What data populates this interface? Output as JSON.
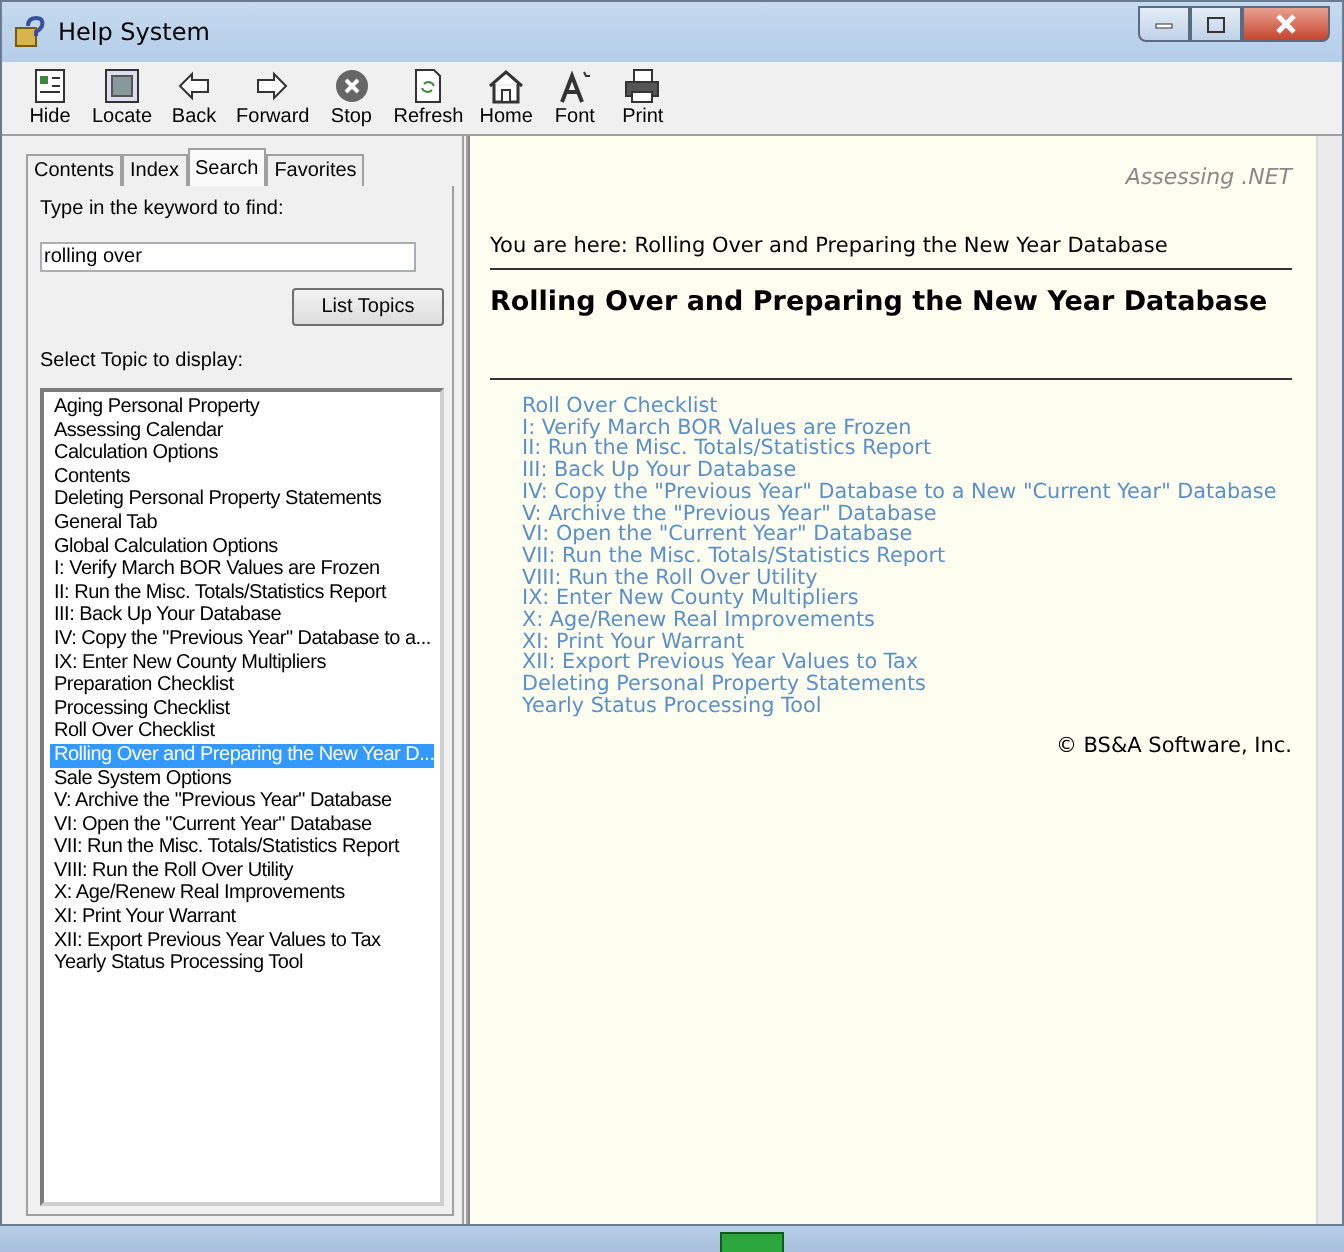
{
  "window": {
    "title": "Help System"
  },
  "toolbar": [
    {
      "label": "Hide",
      "kind": "hide"
    },
    {
      "label": "Locate",
      "kind": "locate"
    },
    {
      "label": "Back",
      "kind": "back"
    },
    {
      "label": "Forward",
      "kind": "forward"
    },
    {
      "label": "Stop",
      "kind": "stop"
    },
    {
      "label": "Refresh",
      "kind": "refresh"
    },
    {
      "label": "Home",
      "kind": "home"
    },
    {
      "label": "Font",
      "kind": "font"
    },
    {
      "label": "Print",
      "kind": "print"
    }
  ],
  "tabs": [
    {
      "label": "Contents",
      "selected": false
    },
    {
      "label": "Index",
      "selected": false
    },
    {
      "label": "Search",
      "selected": true
    },
    {
      "label": "Favorites",
      "selected": false
    }
  ],
  "search": {
    "label": "Type in the keyword to find:",
    "value": "rolling over",
    "button": "List Topics"
  },
  "topics": {
    "label": "Select Topic to display:",
    "items": [
      {
        "label": "Aging Personal Property",
        "selected": false
      },
      {
        "label": "Assessing Calendar",
        "selected": false
      },
      {
        "label": "Calculation Options",
        "selected": false
      },
      {
        "label": "Contents",
        "selected": false
      },
      {
        "label": "Deleting Personal Property Statements",
        "selected": false
      },
      {
        "label": "General Tab",
        "selected": false
      },
      {
        "label": "Global Calculation Options",
        "selected": false
      },
      {
        "label": "I: Verify March BOR Values are Frozen",
        "selected": false
      },
      {
        "label": "II: Run the Misc. Totals/Statistics Report",
        "selected": false
      },
      {
        "label": "III: Back Up Your Database",
        "selected": false
      },
      {
        "label": "IV: Copy the \"Previous Year\" Database to a...",
        "selected": false
      },
      {
        "label": "IX: Enter New County Multipliers",
        "selected": false
      },
      {
        "label": "Preparation Checklist",
        "selected": false
      },
      {
        "label": "Processing Checklist",
        "selected": false
      },
      {
        "label": "Roll Over Checklist",
        "selected": false
      },
      {
        "label": "Rolling Over and Preparing the New Year D...",
        "selected": true
      },
      {
        "label": "Sale System Options",
        "selected": false
      },
      {
        "label": "V: Archive the \"Previous Year\" Database",
        "selected": false
      },
      {
        "label": "VI: Open the \"Current Year\" Database",
        "selected": false
      },
      {
        "label": "VII: Run the Misc. Totals/Statistics Report",
        "selected": false
      },
      {
        "label": "VIII: Run the Roll Over Utility",
        "selected": false
      },
      {
        "label": "X: Age/Renew Real Improvements",
        "selected": false
      },
      {
        "label": "XI: Print Your Warrant",
        "selected": false
      },
      {
        "label": "XII: Export Previous Year Values to Tax",
        "selected": false
      },
      {
        "label": "Yearly Status Processing Tool",
        "selected": false
      }
    ]
  },
  "content": {
    "brand": "Assessing .NET",
    "breadcrumb": "You are here: Rolling Over and Preparing the New Year Database",
    "heading": "Rolling Over and Preparing the New Year Database",
    "links": [
      "Roll Over Checklist",
      "I: Verify March BOR Values are Frozen",
      "II: Run the Misc. Totals/Statistics Report",
      "III: Back Up Your Database",
      "IV: Copy the \"Previous Year\" Database to a New \"Current Year\" Database",
      "V: Archive the \"Previous Year\" Database",
      "VI: Open the \"Current Year\" Database",
      "VII: Run the Misc. Totals/Statistics Report",
      "VIII: Run the Roll Over Utility",
      "IX: Enter New County Multipliers",
      "X: Age/Renew Real Improvements",
      "XI: Print Your Warrant",
      "XII: Export Previous Year Values to Tax",
      "Deleting Personal Property Statements",
      "Yearly Status Processing Tool"
    ],
    "copyright": "© BS&A Software, Inc."
  }
}
